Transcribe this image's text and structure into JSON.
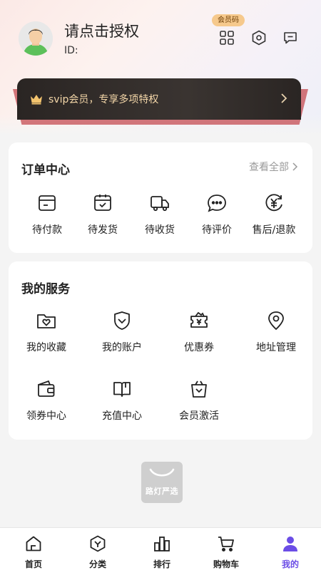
{
  "profile": {
    "name": "请点击授权",
    "id_label": "ID:",
    "member_code_badge": "会员码"
  },
  "svip": {
    "label": "svip会员，专享多项特权"
  },
  "orders": {
    "title": "订单中心",
    "view_all": "查看全部",
    "items": [
      {
        "label": "待付款",
        "icon": "wallet-card-icon"
      },
      {
        "label": "待发货",
        "icon": "box-check-icon"
      },
      {
        "label": "待收货",
        "icon": "delivery-truck-icon"
      },
      {
        "label": "待评价",
        "icon": "chat-bubble-icon"
      },
      {
        "label": "售后/退款",
        "icon": "yen-refund-icon"
      }
    ]
  },
  "services": {
    "title": "我的服务",
    "items": [
      {
        "label": "我的收藏",
        "icon": "folder-heart-icon"
      },
      {
        "label": "我的账户",
        "icon": "shield-account-icon"
      },
      {
        "label": "优惠券",
        "icon": "coupon-yen-icon"
      },
      {
        "label": "地址管理",
        "icon": "location-pin-icon"
      },
      {
        "label": "领券中心",
        "icon": "wallet-icon"
      },
      {
        "label": "充值中心",
        "icon": "book-open-icon"
      },
      {
        "label": "会员激活",
        "icon": "bag-check-icon"
      }
    ]
  },
  "brand": {
    "logo_text": "路灯严选"
  },
  "tabbar": {
    "items": [
      {
        "label": "首页",
        "icon": "home-icon"
      },
      {
        "label": "分类",
        "icon": "category-icon"
      },
      {
        "label": "排行",
        "icon": "ranking-icon"
      },
      {
        "label": "购物车",
        "icon": "cart-icon"
      },
      {
        "label": "我的",
        "icon": "user-icon",
        "active": true
      }
    ]
  },
  "colors": {
    "accent": "#6b4de6",
    "svip_bg": "#2a2523",
    "svip_text": "#f3d6a8",
    "badge": "#f6c98c"
  }
}
